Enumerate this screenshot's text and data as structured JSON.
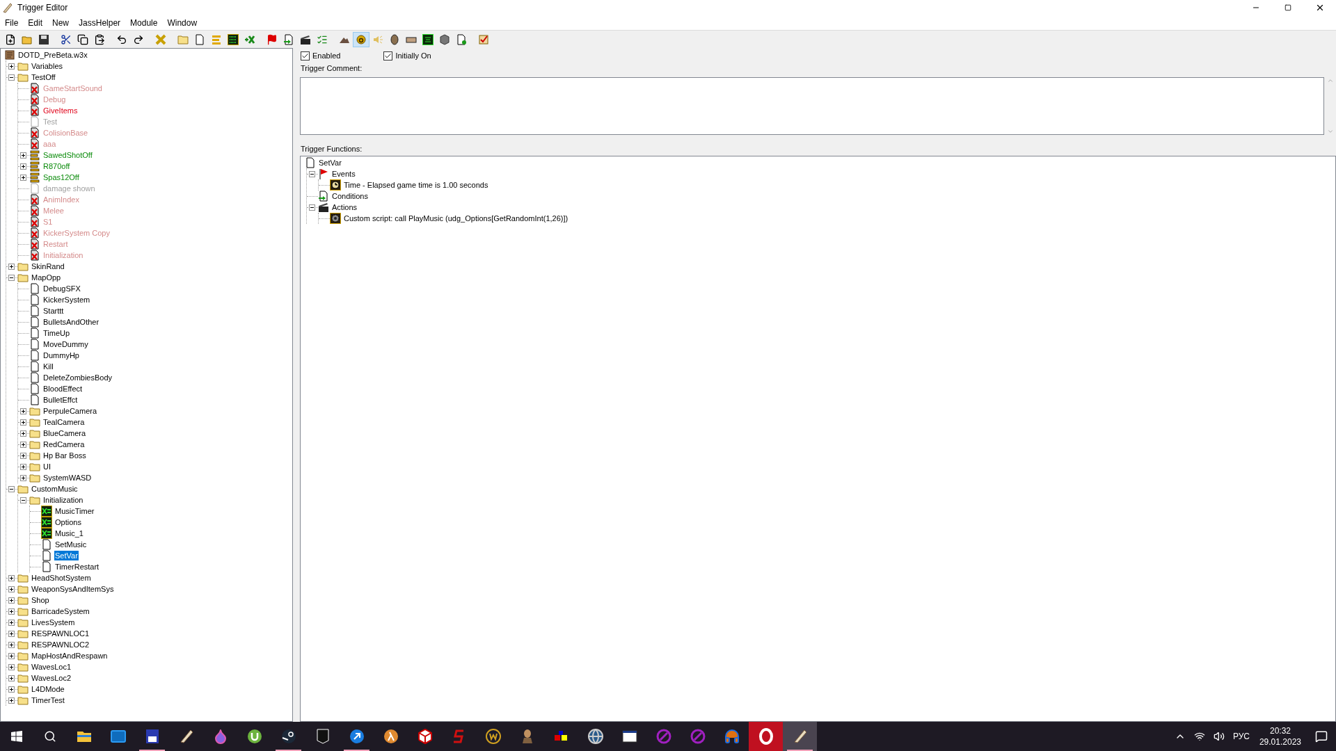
{
  "window": {
    "title": "Trigger Editor"
  },
  "menu": [
    "File",
    "Edit",
    "New",
    "JassHelper",
    "Module",
    "Window"
  ],
  "toolbar": [
    {
      "kind": "new",
      "selected": false
    },
    {
      "kind": "open",
      "selected": false
    },
    {
      "kind": "save",
      "selected": false
    },
    {
      "kind": "sep"
    },
    {
      "kind": "cut",
      "selected": false
    },
    {
      "kind": "copy",
      "selected": false
    },
    {
      "kind": "paste",
      "selected": false
    },
    {
      "kind": "sep"
    },
    {
      "kind": "undo",
      "selected": false
    },
    {
      "kind": "redo",
      "selected": false
    },
    {
      "kind": "sep"
    },
    {
      "kind": "xgold",
      "selected": false
    },
    {
      "kind": "sep"
    },
    {
      "kind": "category",
      "selected": false
    },
    {
      "kind": "trigger",
      "selected": false
    },
    {
      "kind": "bars",
      "selected": false
    },
    {
      "kind": "binary",
      "selected": false
    },
    {
      "kind": "addx",
      "selected": false
    },
    {
      "kind": "sep"
    },
    {
      "kind": "flag",
      "selected": false
    },
    {
      "kind": "import",
      "selected": false
    },
    {
      "kind": "clapper",
      "selected": false
    },
    {
      "kind": "checklist",
      "selected": false
    },
    {
      "kind": "sep"
    },
    {
      "kind": "terrain",
      "selected": false
    },
    {
      "kind": "letter",
      "selected": true
    },
    {
      "kind": "sound",
      "selected": false
    },
    {
      "kind": "unit",
      "selected": false
    },
    {
      "kind": "item",
      "selected": false
    },
    {
      "kind": "ai",
      "selected": false
    },
    {
      "kind": "cube",
      "selected": false
    },
    {
      "kind": "docadd",
      "selected": false
    },
    {
      "kind": "sep"
    },
    {
      "kind": "check",
      "selected": false
    }
  ],
  "tree": {
    "label": "DOTD_PreBeta.w3x",
    "kind": "map",
    "selected": false,
    "children": [
      {
        "label": "Variables",
        "kind": "folder",
        "expanded": false,
        "selected": false
      },
      {
        "label": "TestOff",
        "kind": "folder",
        "expanded": true,
        "selected": false,
        "children": [
          {
            "label": "GameStartSound",
            "kind": "disabled",
            "selected": false,
            "color": "#d48a8a"
          },
          {
            "label": "Debug",
            "kind": "disabled",
            "selected": false,
            "color": "#d48a8a"
          },
          {
            "label": "GiveItems",
            "kind": "disabled",
            "selected": false,
            "color": "#e00018"
          },
          {
            "label": "Test",
            "kind": "trigger_off",
            "selected": false,
            "color": "#a0a0a0"
          },
          {
            "label": "ColisionBase",
            "kind": "disabled",
            "selected": false,
            "color": "#d48a8a"
          },
          {
            "label": "aaa",
            "kind": "disabled",
            "selected": false,
            "color": "#d48a8a"
          },
          {
            "label": "SawedShotOff",
            "kind": "bars",
            "expanded": false,
            "selected": false,
            "color": "#088a08"
          },
          {
            "label": "R870off",
            "kind": "bars",
            "expanded": false,
            "selected": false,
            "color": "#088a08"
          },
          {
            "label": "Spas12Off",
            "kind": "bars",
            "expanded": false,
            "selected": false,
            "color": "#088a08"
          },
          {
            "label": "damage shown",
            "kind": "trigger_off",
            "selected": false,
            "color": "#a0a0a0"
          },
          {
            "label": "AnimIndex",
            "kind": "disabled",
            "selected": false,
            "color": "#d48a8a"
          },
          {
            "label": "Melee",
            "kind": "disabled",
            "selected": false,
            "color": "#d48a8a"
          },
          {
            "label": "S1",
            "kind": "disabled",
            "selected": false,
            "color": "#d48a8a"
          },
          {
            "label": "KickerSystem Copy",
            "kind": "disabled",
            "selected": false,
            "color": "#d48a8a"
          },
          {
            "label": "Restart",
            "kind": "disabled",
            "selected": false,
            "color": "#d48a8a"
          },
          {
            "label": "Initialization",
            "kind": "disabled",
            "selected": false,
            "color": "#d48a8a"
          }
        ]
      },
      {
        "label": "SkinRand",
        "kind": "folder",
        "expanded": false,
        "selected": false
      },
      {
        "label": "MapOpp",
        "kind": "folder",
        "expanded": true,
        "selected": false,
        "children": [
          {
            "label": "DebugSFX",
            "kind": "trigger",
            "selected": false
          },
          {
            "label": "KickerSystem",
            "kind": "trigger",
            "selected": false
          },
          {
            "label": "Starttt",
            "kind": "trigger",
            "selected": false
          },
          {
            "label": "BulletsAndOther",
            "kind": "trigger",
            "selected": false
          },
          {
            "label": "TimeUp",
            "kind": "trigger",
            "selected": false
          },
          {
            "label": "MoveDummy",
            "kind": "trigger",
            "selected": false
          },
          {
            "label": "DummyHp",
            "kind": "trigger",
            "selected": false
          },
          {
            "label": "Kill",
            "kind": "trigger",
            "selected": false
          },
          {
            "label": "DeleteZombiesBody",
            "kind": "trigger",
            "selected": false
          },
          {
            "label": "BloodEffect",
            "kind": "trigger",
            "selected": false
          },
          {
            "label": "BulletEffct",
            "kind": "trigger",
            "selected": false
          },
          {
            "label": "PerpuleCamera",
            "kind": "folder",
            "expanded": false,
            "selected": false
          },
          {
            "label": "TealCamera",
            "kind": "folder",
            "expanded": false,
            "selected": false
          },
          {
            "label": "BlueCamera",
            "kind": "folder",
            "expanded": false,
            "selected": false
          },
          {
            "label": "RedCamera",
            "kind": "folder",
            "expanded": false,
            "selected": false
          },
          {
            "label": "Hp Bar Boss",
            "kind": "folder",
            "expanded": false,
            "selected": false
          },
          {
            "label": "UI",
            "kind": "folder",
            "expanded": false,
            "selected": false
          },
          {
            "label": "SystemWASD",
            "kind": "folder",
            "expanded": false,
            "selected": false
          }
        ]
      },
      {
        "label": "CustomMusic",
        "kind": "folder",
        "expanded": true,
        "selected": false,
        "children": [
          {
            "label": "Initialization",
            "kind": "folder",
            "expanded": true,
            "selected": false,
            "children": [
              {
                "label": "MusicTimer",
                "kind": "variable",
                "selected": false
              },
              {
                "label": "Options",
                "kind": "variable",
                "selected": false
              },
              {
                "label": "Music_1",
                "kind": "variable",
                "selected": false
              },
              {
                "label": "SetMusic",
                "kind": "trigger",
                "selected": false
              },
              {
                "label": "SetVar",
                "kind": "trigger",
                "selected": true
              },
              {
                "label": "TimerRestart",
                "kind": "trigger",
                "selected": false
              }
            ]
          }
        ]
      },
      {
        "label": "HeadShotSystem",
        "kind": "folder",
        "expanded": false,
        "selected": false
      },
      {
        "label": "WeaponSysAndItemSys",
        "kind": "folder",
        "expanded": false,
        "selected": false
      },
      {
        "label": "Shop",
        "kind": "folder",
        "expanded": false,
        "selected": false
      },
      {
        "label": "BarricadeSystem",
        "kind": "folder",
        "expanded": false,
        "selected": false
      },
      {
        "label": "LivesSystem",
        "kind": "folder",
        "expanded": false,
        "selected": false
      },
      {
        "label": "RESPAWNLOC1",
        "kind": "folder",
        "expanded": false,
        "selected": false
      },
      {
        "label": "RESPAWNLOC2",
        "kind": "folder",
        "expanded": false,
        "selected": false
      },
      {
        "label": "MapHostAndRespawn",
        "kind": "folder",
        "expanded": false,
        "selected": false
      },
      {
        "label": "WavesLoc1",
        "kind": "folder",
        "expanded": false,
        "selected": false
      },
      {
        "label": "WavesLoc2",
        "kind": "folder",
        "expanded": false,
        "selected": false
      },
      {
        "label": "L4DMode",
        "kind": "folder",
        "expanded": false,
        "selected": false
      },
      {
        "label": "TimerTest",
        "kind": "folder",
        "expanded": false,
        "selected": false
      }
    ]
  },
  "trigger": {
    "enabled": {
      "label": "Enabled",
      "checked": true
    },
    "initially_on": {
      "label": "Initially On",
      "checked": true
    },
    "comment_label": "Trigger Comment:",
    "functions_label": "Trigger Functions:",
    "functions": {
      "label": "SetVar",
      "kind": "trigger",
      "children": [
        {
          "label": "Events",
          "kind": "events",
          "expanded": true,
          "children": [
            {
              "label": "Time - Elapsed game time is 1.00 seconds",
              "kind": "event"
            }
          ]
        },
        {
          "label": "Conditions",
          "kind": "conditions"
        },
        {
          "label": "Actions",
          "kind": "actions",
          "expanded": true,
          "children": [
            {
              "label": "Custom script:   call PlayMusic (udg_Options[GetRandomInt(1,26)])",
              "kind": "action"
            }
          ]
        }
      ]
    }
  },
  "taskbar": {
    "apps": [
      {
        "kind": "explorer",
        "running": false,
        "active": false
      },
      {
        "kind": "mail",
        "running": false,
        "active": false
      },
      {
        "kind": "disk",
        "running": true,
        "active": false
      },
      {
        "kind": "quill",
        "running": false,
        "active": false
      },
      {
        "kind": "drop",
        "running": false,
        "active": false
      },
      {
        "kind": "torrent",
        "running": false,
        "active": false
      },
      {
        "kind": "steam",
        "running": true,
        "active": false
      },
      {
        "kind": "epic",
        "running": false,
        "active": false
      },
      {
        "kind": "bluearrow",
        "running": true,
        "active": false
      },
      {
        "kind": "lambda",
        "running": false,
        "active": false
      },
      {
        "kind": "box",
        "running": false,
        "active": false
      },
      {
        "kind": "reds",
        "running": false,
        "active": false
      },
      {
        "kind": "wcircle",
        "running": false,
        "active": false
      },
      {
        "kind": "figure",
        "running": false,
        "active": false
      },
      {
        "kind": "squares",
        "running": false,
        "active": false
      },
      {
        "kind": "globe",
        "running": false,
        "active": false
      },
      {
        "kind": "window",
        "running": false,
        "active": false
      },
      {
        "kind": "purple",
        "running": false,
        "active": false
      },
      {
        "kind": "purple",
        "running": false,
        "active": false
      },
      {
        "kind": "headphones",
        "running": false,
        "active": false
      },
      {
        "kind": "opera",
        "running": false,
        "active": false
      },
      {
        "kind": "quill",
        "running": true,
        "active": true
      }
    ],
    "language": "РУС",
    "time": "20:32",
    "date": "29.01.2023"
  }
}
